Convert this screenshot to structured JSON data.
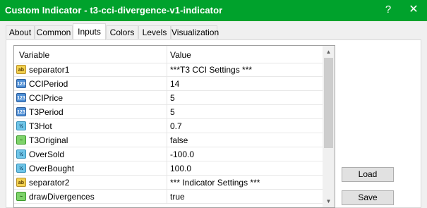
{
  "window": {
    "title": "Custom Indicator - t3-cci-divergence-v1-indicator",
    "help": "?",
    "close": "✕"
  },
  "tabs": [
    {
      "label": "About"
    },
    {
      "label": "Common"
    },
    {
      "label": "Inputs",
      "active": true
    },
    {
      "label": "Colors"
    },
    {
      "label": "Levels"
    },
    {
      "label": "Visualization"
    }
  ],
  "grid": {
    "col_variable": "Variable",
    "col_value": "Value",
    "rows": [
      {
        "icon": "ab",
        "icon_text": "ab",
        "name": "separator1",
        "value": "***T3 CCI Settings ***"
      },
      {
        "icon": "123",
        "icon_text": "123",
        "name": "CCIPeriod",
        "value": "14"
      },
      {
        "icon": "123",
        "icon_text": "123",
        "name": "CCIPrice",
        "value": "5"
      },
      {
        "icon": "123",
        "icon_text": "123",
        "name": "T3Period",
        "value": "5"
      },
      {
        "icon": "frac",
        "icon_text": "½",
        "name": "T3Hot",
        "value": "0.7"
      },
      {
        "icon": "bool",
        "icon_text": "~",
        "name": "T3Original",
        "value": "false"
      },
      {
        "icon": "frac",
        "icon_text": "½",
        "name": "OverSold",
        "value": "-100.0"
      },
      {
        "icon": "frac",
        "icon_text": "½",
        "name": "OverBought",
        "value": "100.0"
      },
      {
        "icon": "ab",
        "icon_text": "ab",
        "name": "separator2",
        "value": "*** Indicator Settings ***"
      },
      {
        "icon": "bool",
        "icon_text": "~",
        "name": "drawDivergences",
        "value": "true"
      }
    ]
  },
  "scrollbar": {
    "up": "▲",
    "down": "▼"
  },
  "buttons": {
    "load": "Load",
    "save": "Save"
  }
}
